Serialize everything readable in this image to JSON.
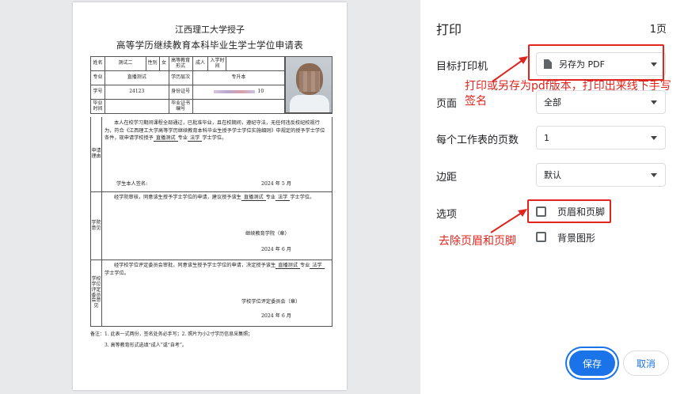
{
  "document": {
    "title1": "江西理工大学授子",
    "title2": "高等学历继续教育本科毕业生学士学位申请表",
    "r1": {
      "name_lbl": "姓名",
      "name_val": "测试二",
      "gender_lbl": "性别",
      "gender_val": "女",
      "edu_form_lbl": "高等教育形式",
      "edu_form_val": "成人",
      "enroll_lbl": "入学时间"
    },
    "r2": {
      "major_lbl": "专业",
      "major_val": "直播测试",
      "level_lbl": "学历层次",
      "level_val": "专升本"
    },
    "r3": {
      "id_lbl": "学号",
      "id_val": "24123",
      "idcard_lbl": "身份证号",
      "idcard_val": "10"
    },
    "r4": {
      "grad_time_lbl": "毕业时间",
      "cert_lbl": "毕业证书编号"
    },
    "apply": {
      "label": "申请理由",
      "text1": "本人在校学习期间课程全部通过，已批准毕业，且在校期间，遵纪守法，无任何违反校纪校规行为，符合《江西理工大学高等学历继续教育本科毕业生授予学士学位实施细则》中规定的授予学士学位条件，现申请学校授予",
      "major": "直播测试",
      "text2": "专业",
      "subject": "法学",
      "text3": "学士学位。",
      "sign": "学生本人签名:",
      "date": "2024 年 5 月"
    },
    "college": {
      "label": "学院意见",
      "text1": "经学院审核，同意该生授予学士学位的申请，建议授予该生",
      "major": "直播测试",
      "text2": "专业",
      "subject": "法学",
      "text3": "学士学位。",
      "org": "继续教育学院（章）",
      "date": "2024 年 6 月"
    },
    "committee": {
      "label": "学校学位评定委员会意见",
      "text1": "经学校学位评定委员会审批，同意该生授予学士学位的申请，决定授予该生",
      "major": "直播测试",
      "text2": "专业",
      "subject": "法学",
      "text3": "学士学位。",
      "org": "学校学位评定委员会（章）",
      "date": "2024 年 6 月"
    },
    "note1": "备注：1. 此表一式两份，签名处务必手写；2. 照片为小2寸学历信息采集照；",
    "note2": "3. 高等教育形式选填“成人”或“自考”。"
  },
  "panel": {
    "title": "打印",
    "page_count": "1页",
    "destination_label": "目标打印机",
    "destination_value": "另存为 PDF",
    "pages_label": "页面",
    "pages_value": "全部",
    "per_sheet_label": "每个工作表的页数",
    "per_sheet_value": "1",
    "margin_label": "边距",
    "margin_value": "默认",
    "options_label": "选项",
    "opt_headers": "页眉和页脚",
    "opt_background": "背景图形",
    "save": "保存",
    "cancel": "取消"
  },
  "annotations": {
    "print_note": "打印或另存为pdf版本，打印出来线下手写签名",
    "remove_note": "去除页眉和页脚"
  },
  "colors": {
    "accent": "#1a73e8",
    "annotation": "#e0241e"
  },
  "icons": [
    "file-icon",
    "dropdown-arrow-icon",
    "checkbox-icon",
    "arrow-icon"
  ]
}
